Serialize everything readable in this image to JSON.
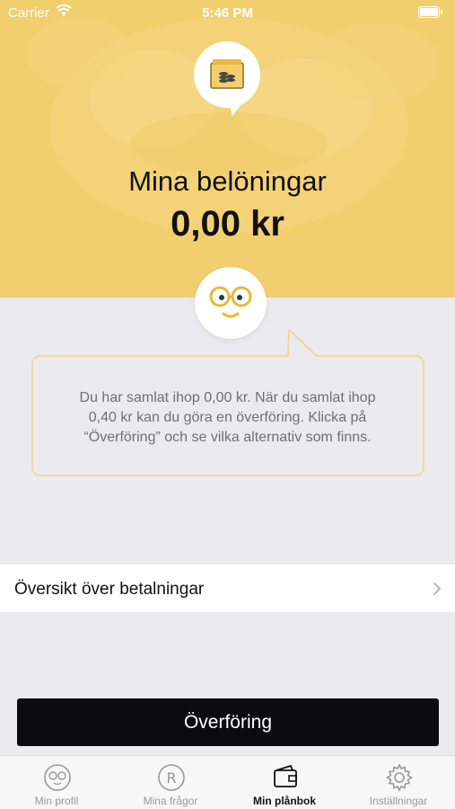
{
  "status_bar": {
    "carrier": "Carrier",
    "time": "5:46 PM"
  },
  "hero": {
    "title": "Mina belöningar",
    "amount": "0,00 kr"
  },
  "info": {
    "line1": "Du har samlat ihop 0,00 kr. När du samlat ihop",
    "line2": "0,40 kr kan du göra en överföring. Klicka på",
    "line3": "“Överföring” och se vilka alternativ som finns."
  },
  "payments_row": {
    "label": "Översikt över betalningar"
  },
  "transfer_button": {
    "label": "Överföring"
  },
  "tabs": [
    {
      "label": "Min profil",
      "icon": "face-icon",
      "active": false
    },
    {
      "label": "Mina frågor",
      "icon": "registered-icon",
      "active": false
    },
    {
      "label": "Min plånbok",
      "icon": "wallet-icon",
      "active": true
    },
    {
      "label": "Inställningar",
      "icon": "gear-icon",
      "active": false
    }
  ],
  "colors": {
    "accent_yellow": "#f2cf6e",
    "accent_gold": "#e7b93c",
    "background": "#ebeaef",
    "button_dark": "#0c0b12"
  }
}
